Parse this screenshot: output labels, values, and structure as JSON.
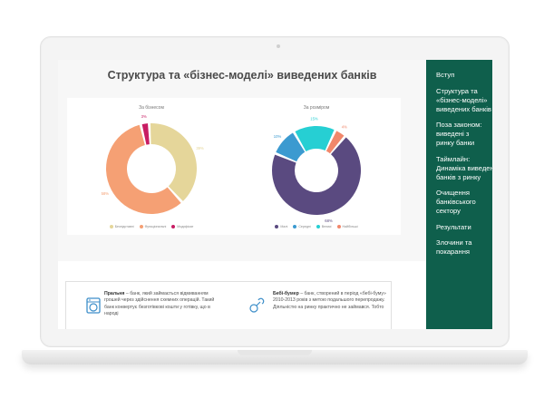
{
  "page": {
    "title": "Структура та «бізнес-моделі» виведених банків"
  },
  "charts_meta": {
    "left_title": "За бізнесом",
    "right_title": "За розміром"
  },
  "chart_data": [
    {
      "type": "pie",
      "title": "За бізнесом",
      "donut": true,
      "slices": [
        {
          "name": "Безпідставні",
          "value": 39,
          "label": "39%",
          "color": "#e5d69a"
        },
        {
          "name": "Функціональні",
          "value": 58,
          "label": "58%",
          "color": "#f5a074"
        },
        {
          "name": "Модифікат",
          "value": 3,
          "label": "3%",
          "color": "#c81d63"
        }
      ]
    },
    {
      "type": "pie",
      "title": "За розміром",
      "donut": true,
      "slices": [
        {
          "name": "Малі",
          "value": 68,
          "label": "68%",
          "color": "#5a4a80"
        },
        {
          "name": "Середні",
          "value": 10,
          "label": "10%",
          "color": "#3b9ad0"
        },
        {
          "name": "Великі",
          "value": 15,
          "label": "15%",
          "color": "#26cfd3"
        },
        {
          "name": "Найбільші",
          "value": 4,
          "label": "4%",
          "color": "#f1876b"
        }
      ]
    }
  ],
  "terms": [
    {
      "term": "Пральня",
      "definition": " – банк, який займається відмиванням грошей через здійснення схемних операцій. Такий банк конвертує безготівкові кошти у готівку, що в народі",
      "icon": "washing-machine-icon"
    },
    {
      "term": "Бебі-бумер",
      "definition": " – банк, створений в період «бебі-буму» 2010-2013 років з метою подальшого перепродажу. Діяльністю на ринку практично не займався. Тобто",
      "icon": "pacifier-icon"
    }
  ],
  "sidebar": {
    "items": [
      {
        "label": "Вступ"
      },
      {
        "label": "Структура та «бізнес-моделі» виведених банків"
      },
      {
        "label": "Поза законом: виведені з ринку банки"
      },
      {
        "label": "Таймлайн: Динаміка виведення банків з ринку"
      },
      {
        "label": "Очищення банківського сектору"
      },
      {
        "label": "Результати"
      },
      {
        "label": "Злочини та покарання"
      }
    ]
  },
  "colors": {
    "sidebar_bg": "#0f5f4c",
    "icon_blue": "#3d8ec9"
  }
}
